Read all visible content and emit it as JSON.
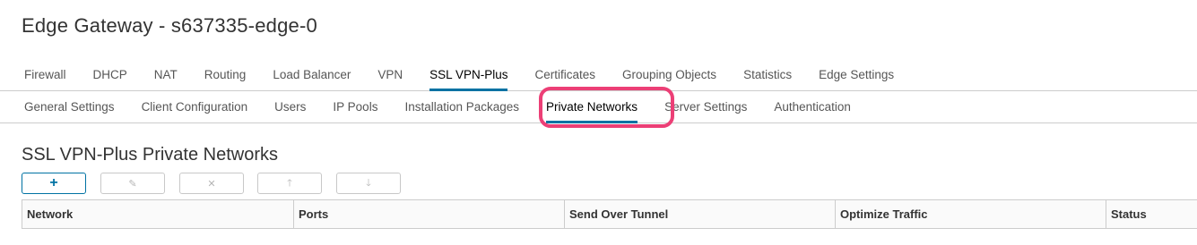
{
  "page": {
    "title": "Edge Gateway - s637335-edge-0"
  },
  "main_tabs": [
    {
      "label": "Firewall"
    },
    {
      "label": "DHCP"
    },
    {
      "label": "NAT"
    },
    {
      "label": "Routing"
    },
    {
      "label": "Load Balancer"
    },
    {
      "label": "VPN"
    },
    {
      "label": "SSL VPN-Plus",
      "active": true
    },
    {
      "label": "Certificates"
    },
    {
      "label": "Grouping Objects"
    },
    {
      "label": "Statistics"
    },
    {
      "label": "Edge Settings"
    }
  ],
  "sub_tabs": [
    {
      "label": "General Settings"
    },
    {
      "label": "Client Configuration"
    },
    {
      "label": "Users"
    },
    {
      "label": "IP Pools"
    },
    {
      "label": "Installation Packages"
    },
    {
      "label": "Private Networks",
      "active": true,
      "highlighted": true
    },
    {
      "label": "Server Settings"
    },
    {
      "label": "Authentication"
    }
  ],
  "section": {
    "title": "SSL VPN-Plus Private Networks"
  },
  "toolbar": {
    "buttons": [
      {
        "icon": "plus-icon",
        "glyph": "+",
        "enabled": true
      },
      {
        "icon": "edit-icon",
        "glyph": "✎",
        "enabled": false
      },
      {
        "icon": "delete-icon",
        "glyph": "✕",
        "enabled": false
      },
      {
        "icon": "move-up-icon",
        "glyph": "🡑",
        "enabled": false
      },
      {
        "icon": "move-down-icon",
        "glyph": "🡓",
        "enabled": false
      }
    ]
  },
  "grid": {
    "columns": [
      "Network",
      "Ports",
      "Send Over Tunnel",
      "Optimize Traffic",
      "Status"
    ]
  },
  "colors": {
    "accent": "#0072a3",
    "highlight": "#ec3f76"
  }
}
